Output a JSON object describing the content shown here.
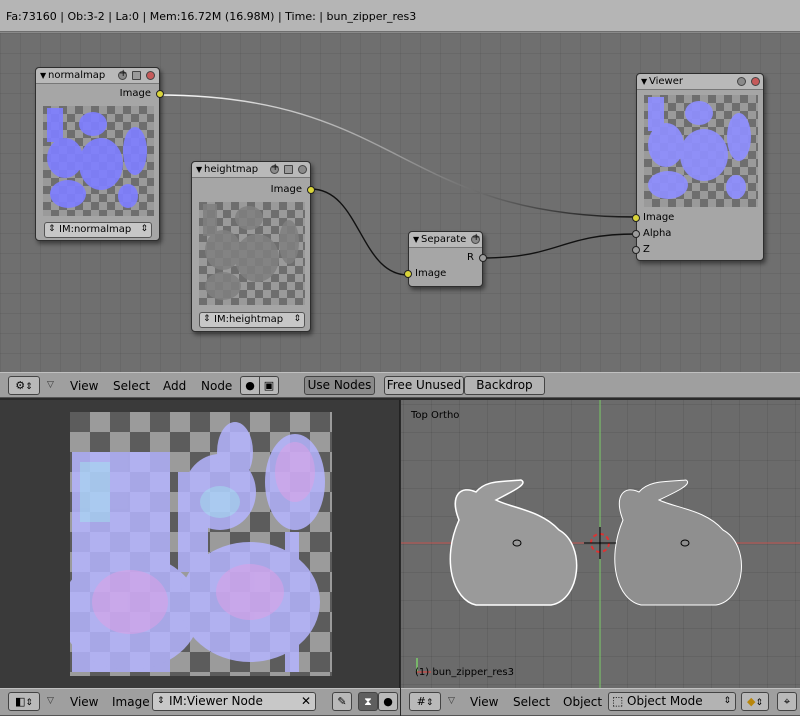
{
  "info_bar": {
    "text": "Fa:73160 | Ob:3-2 | La:0  | Mem:16.72M (16.98M)  | Time:  | bun_zipper_res3"
  },
  "node_editor": {
    "nodes": {
      "normalmap": {
        "title": "normalmap",
        "output": "Image",
        "image_selector": "IM:normalmap"
      },
      "heightmap": {
        "title": "heightmap",
        "output": "Image",
        "image_selector": "IM:heightmap"
      },
      "separate": {
        "title": "Separate",
        "input": "Image",
        "output": "R"
      },
      "viewer": {
        "title": "Viewer",
        "inputs": [
          "Image",
          "Alpha",
          "Z"
        ]
      }
    },
    "header": {
      "menus": [
        "View",
        "Select",
        "Add",
        "Node"
      ],
      "buttons": {
        "use_nodes": "Use Nodes",
        "free_unused": "Free Unused",
        "backdrop": "Backdrop"
      }
    }
  },
  "image_editor": {
    "header": {
      "menus": [
        "View",
        "Image"
      ],
      "image_field": "IM:Viewer Node"
    }
  },
  "view3d": {
    "view_label": "Top Ortho",
    "object_label": "(1) bun_zipper_res3",
    "header": {
      "menus": [
        "View",
        "Select",
        "Object"
      ],
      "mode": "Object Mode"
    }
  },
  "colors": {
    "socket_image": "#d9d43a",
    "socket_value": "#9c9c9c",
    "normal_map_blue": "#7f7fff",
    "x_axis": "#c0504d",
    "y_axis": "#7ccf6a"
  }
}
